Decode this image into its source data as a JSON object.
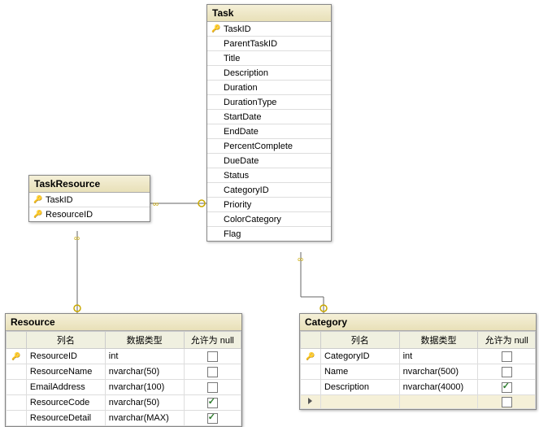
{
  "tables": {
    "task": {
      "title": "Task",
      "fields": [
        {
          "key": true,
          "name": "TaskID"
        },
        {
          "key": false,
          "name": "ParentTaskID"
        },
        {
          "key": false,
          "name": "Title"
        },
        {
          "key": false,
          "name": "Description"
        },
        {
          "key": false,
          "name": "Duration"
        },
        {
          "key": false,
          "name": "DurationType"
        },
        {
          "key": false,
          "name": "StartDate"
        },
        {
          "key": false,
          "name": "EndDate"
        },
        {
          "key": false,
          "name": "PercentComplete"
        },
        {
          "key": false,
          "name": "DueDate"
        },
        {
          "key": false,
          "name": "Status"
        },
        {
          "key": false,
          "name": "CategoryID"
        },
        {
          "key": false,
          "name": "Priority"
        },
        {
          "key": false,
          "name": "ColorCategory"
        },
        {
          "key": false,
          "name": "Flag"
        }
      ]
    },
    "taskResource": {
      "title": "TaskResource",
      "keys": [
        {
          "name": "TaskID"
        },
        {
          "name": "ResourceID"
        }
      ]
    },
    "resource": {
      "title": "Resource",
      "headers": {
        "name": "列名",
        "type": "数据类型",
        "null": "允许为 null"
      },
      "columns": [
        {
          "key": true,
          "name": "ResourceID",
          "type": "int",
          "nullable": false
        },
        {
          "key": false,
          "name": "ResourceName",
          "type": "nvarchar(50)",
          "nullable": false
        },
        {
          "key": false,
          "name": "EmailAddress",
          "type": "nvarchar(100)",
          "nullable": false
        },
        {
          "key": false,
          "name": "ResourceCode",
          "type": "nvarchar(50)",
          "nullable": true
        },
        {
          "key": false,
          "name": "ResourceDetail",
          "type": "nvarchar(MAX)",
          "nullable": true
        }
      ]
    },
    "category": {
      "title": "Category",
      "headers": {
        "name": "列名",
        "type": "数据类型",
        "null": "允许为 null"
      },
      "columns": [
        {
          "key": true,
          "name": "CategoryID",
          "type": "int",
          "nullable": false
        },
        {
          "key": false,
          "name": "Name",
          "type": "nvarchar(500)",
          "nullable": false
        },
        {
          "key": false,
          "name": "Description",
          "type": "nvarchar(4000)",
          "nullable": true
        }
      ]
    }
  },
  "chart_data": {
    "type": "diagram",
    "description": "Entity-relationship diagram with 4 tables",
    "entities": [
      "Task",
      "TaskResource",
      "Resource",
      "Category"
    ],
    "relationships": [
      {
        "from": "TaskResource",
        "to": "Task",
        "type": "many-to-one"
      },
      {
        "from": "TaskResource",
        "to": "Resource",
        "type": "many-to-one"
      },
      {
        "from": "Task",
        "to": "Category",
        "type": "many-to-one"
      }
    ]
  }
}
